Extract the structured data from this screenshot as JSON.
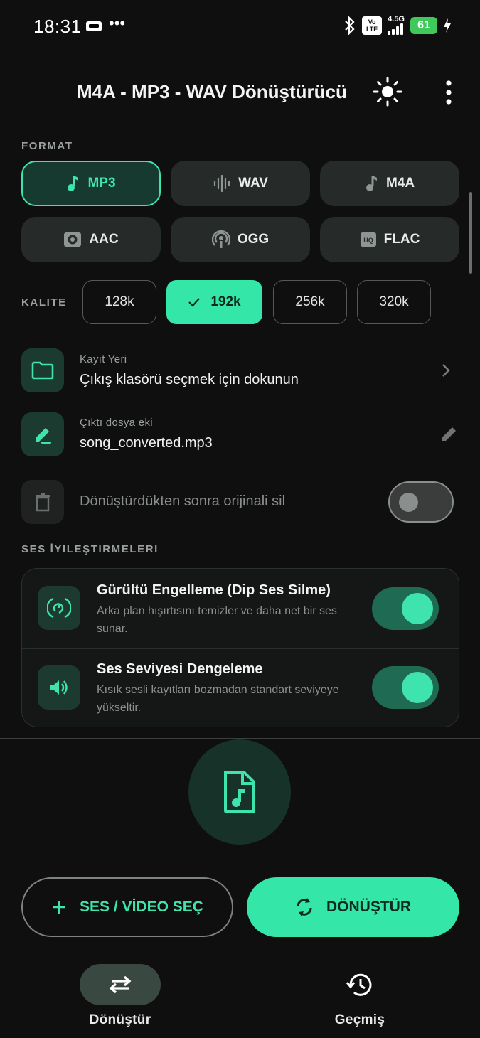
{
  "status_bar": {
    "time": "18:31",
    "network": "4.5G",
    "volte": "Vo LTE",
    "battery": "61"
  },
  "header": {
    "title": "M4A - MP3 - WAV Dönüştürücü",
    "theme_icon": "sun-icon",
    "menu_icon": "more-vert-icon"
  },
  "format": {
    "label": "FORMAT",
    "selected": "MP3",
    "options": [
      {
        "label": "MP3",
        "icon": "music-note-icon"
      },
      {
        "label": "WAV",
        "icon": "waveform-icon"
      },
      {
        "label": "M4A",
        "icon": "music-note-icon"
      },
      {
        "label": "AAC",
        "icon": "speaker-icon"
      },
      {
        "label": "OGG",
        "icon": "podcast-icon"
      },
      {
        "label": "FLAC",
        "icon": "hq-icon"
      }
    ]
  },
  "quality": {
    "label": "KALITE",
    "selected": "192k",
    "options": [
      "128k",
      "192k",
      "256k",
      "320k"
    ]
  },
  "save_location": {
    "label": "Kayıt Yeri",
    "value": "Çıkış klasörü seçmek için dokunun"
  },
  "output_suffix": {
    "label": "Çıktı dosya eki",
    "value": "song_converted.mp3"
  },
  "delete_original": {
    "label": "Dönüştürdükten sonra orijinali sil",
    "enabled": false
  },
  "enhancements": {
    "label": "SES İYILEŞTIRMELERI",
    "items": [
      {
        "title": "Gürültü Engelleme (Dip Ses Silme)",
        "description": "Arka plan hışırtısını temizler ve daha net bir ses sunar.",
        "enabled": true
      },
      {
        "title": "Ses Seviyesi Dengeleme",
        "description": "Kısık sesli kayıtları bozmadan standart seviyeye yükseltir.",
        "enabled": true
      }
    ]
  },
  "actions": {
    "select_label": "SES / VİDEO SEÇ",
    "convert_label": "DÖNÜŞTÜR"
  },
  "bottom_nav": {
    "items": [
      {
        "label": "Dönüştür",
        "active": true
      },
      {
        "label": "Geçmiş",
        "active": false
      }
    ]
  },
  "colors": {
    "accent": "#34e6a8",
    "background": "#0f0f0f",
    "surface": "#262a29"
  }
}
